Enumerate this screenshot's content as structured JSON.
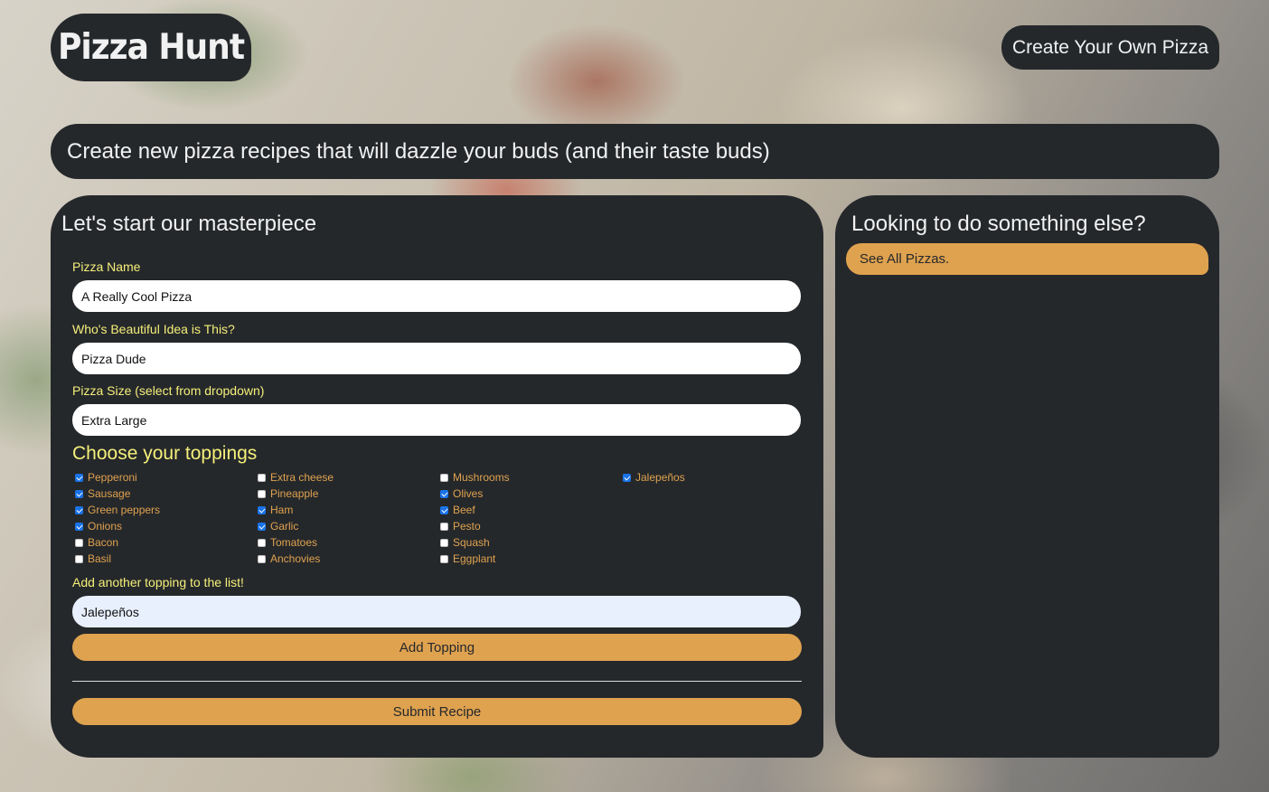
{
  "header": {
    "logo_text": "Pizza Hunt",
    "create_own_label": "Create Your Own Pizza"
  },
  "tagline": "Create new pizza recipes that will dazzle your buds (and their taste buds)",
  "form": {
    "title": "Let's start our masterpiece",
    "pizza_name_label": "Pizza Name",
    "pizza_name_value": "A Really Cool Pizza",
    "creator_label": "Who's Beautiful Idea is This?",
    "creator_value": "Pizza Dude",
    "size_label": "Pizza Size (select from dropdown)",
    "size_value": "Extra Large",
    "toppings_title": "Choose your toppings",
    "toppings": [
      {
        "label": "Pepperoni",
        "checked": true
      },
      {
        "label": "Sausage",
        "checked": true
      },
      {
        "label": "Green peppers",
        "checked": true
      },
      {
        "label": "Onions",
        "checked": true
      },
      {
        "label": "Bacon",
        "checked": false
      },
      {
        "label": "Basil",
        "checked": false
      },
      {
        "label": "Extra cheese",
        "checked": false
      },
      {
        "label": "Pineapple",
        "checked": false
      },
      {
        "label": "Ham",
        "checked": true
      },
      {
        "label": "Garlic",
        "checked": true
      },
      {
        "label": "Tomatoes",
        "checked": false
      },
      {
        "label": "Anchovies",
        "checked": false
      },
      {
        "label": "Mushrooms",
        "checked": false
      },
      {
        "label": "Olives",
        "checked": true
      },
      {
        "label": "Beef",
        "checked": true
      },
      {
        "label": "Pesto",
        "checked": false
      },
      {
        "label": "Squash",
        "checked": false
      },
      {
        "label": "Eggplant",
        "checked": false
      },
      {
        "label": "Jalepeños",
        "checked": true
      }
    ],
    "add_topping_label": "Add another topping to the list!",
    "add_topping_value": "Jalepeños",
    "add_topping_button": "Add Topping",
    "submit_button": "Submit Recipe"
  },
  "sidebar": {
    "title": "Looking to do something else?",
    "see_all_label": "See All Pizzas."
  },
  "colors": {
    "panel": "#25282b",
    "accent": "#dfa24f",
    "label": "#f5ef7a"
  }
}
